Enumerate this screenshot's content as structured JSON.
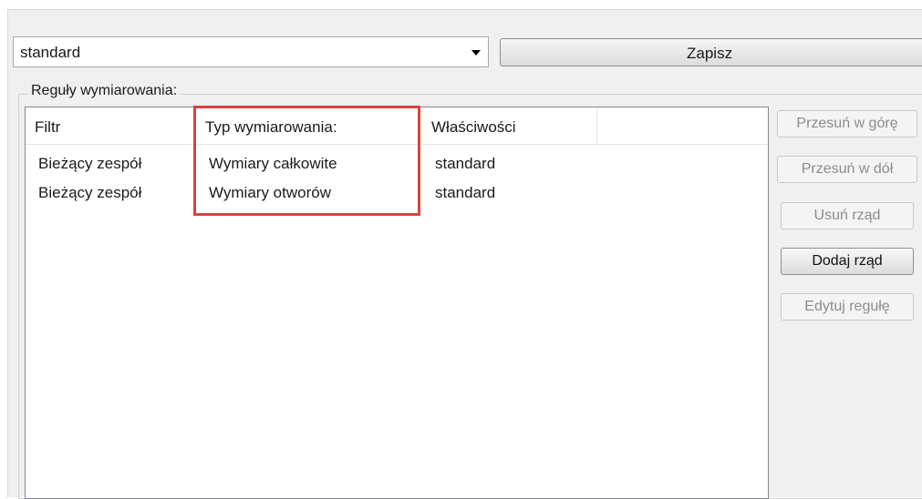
{
  "preset": {
    "selected_value": "standard",
    "save_label": "Zapisz"
  },
  "rules_group": {
    "label": "Reguły wymiarowania:"
  },
  "table": {
    "columns": [
      "Filtr",
      "Typ wymiarowania:",
      "Właściwości",
      ""
    ],
    "rows": [
      [
        "Bieżący zespół",
        "Wymiary całkowite",
        "standard"
      ],
      [
        "Bieżący zespół",
        "Wymiary otworów",
        "standard"
      ]
    ]
  },
  "actions": {
    "move_up": "Przesuń w górę",
    "move_down": "Przesuń w dół",
    "remove_row": "Usuń rząd",
    "add_row": "Dodaj rząd",
    "edit_rule": "Edytuj regułę"
  },
  "colors": {
    "highlight": "#d9423f",
    "panel_bg": "#f0f0f0"
  }
}
